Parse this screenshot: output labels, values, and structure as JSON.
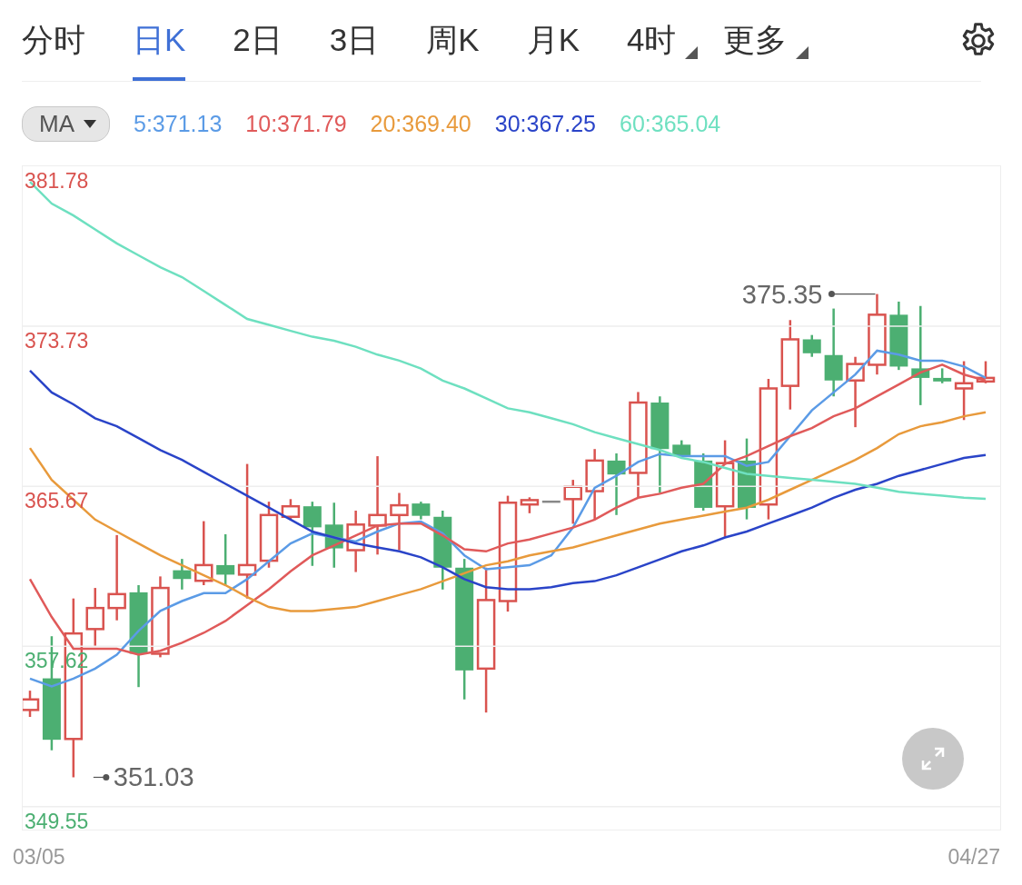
{
  "tabs": [
    {
      "label": "分时",
      "selected": false,
      "has_menu": false
    },
    {
      "label": "日K",
      "selected": true,
      "has_menu": false
    },
    {
      "label": "2日",
      "selected": false,
      "has_menu": false
    },
    {
      "label": "3日",
      "selected": false,
      "has_menu": false
    },
    {
      "label": "周K",
      "selected": false,
      "has_menu": false
    },
    {
      "label": "月K",
      "selected": false,
      "has_menu": false
    },
    {
      "label": "4时",
      "selected": false,
      "has_menu": true
    },
    {
      "label": "更多",
      "selected": false,
      "has_menu": true
    }
  ],
  "indicator_dropdown": {
    "label": "MA"
  },
  "chart": {
    "chart_data": {
      "type": "line",
      "ylim": [
        348.4,
        381.78
      ],
      "yticks": [
        381.78,
        373.73,
        365.67,
        357.62,
        349.55
      ],
      "series": [
        {
          "name": "5:371.13",
          "color": "#5b9be6",
          "values": [
            356.0,
            355.6,
            356.0,
            356.5,
            357.2,
            358.4,
            359.4,
            359.9,
            360.3,
            360.3,
            361.0,
            361.9,
            362.8,
            363.3,
            363.1,
            362.9,
            363.4,
            363.8,
            363.9,
            363.3,
            362.2,
            361.5,
            361.6,
            361.7,
            362.2,
            363.6,
            365.6,
            366.2,
            366.9,
            367.3,
            367.2,
            367.2,
            367.2,
            366.7,
            366.9,
            368.2,
            369.5,
            370.4,
            371.3,
            372.5,
            372.3,
            372.0,
            372.0,
            371.7,
            371.13
          ]
        },
        {
          "name": "10:371.79",
          "color": "#e05a5a",
          "values": [
            361.0,
            359.1,
            357.5,
            357.5,
            357.5,
            357.2,
            357.4,
            357.8,
            358.3,
            358.9,
            359.7,
            360.5,
            361.4,
            362.2,
            362.7,
            363.2,
            363.7,
            363.8,
            363.8,
            363.2,
            362.5,
            362.4,
            362.8,
            363.0,
            363.3,
            363.6,
            364.0,
            364.6,
            365.1,
            365.3,
            365.6,
            365.8,
            366.8,
            367.2,
            367.7,
            368.2,
            368.6,
            369.2,
            369.6,
            370.2,
            370.8,
            371.4,
            371.8,
            371.3,
            371.0
          ]
        },
        {
          "name": "20:369.40",
          "color": "#e89a3c",
          "values": [
            367.6,
            366.0,
            365.0,
            364.0,
            363.4,
            362.8,
            362.2,
            361.7,
            361.2,
            360.7,
            360.1,
            359.6,
            359.4,
            359.4,
            359.5,
            359.6,
            359.9,
            360.2,
            360.5,
            360.9,
            361.3,
            361.7,
            361.9,
            362.2,
            362.4,
            362.6,
            362.9,
            363.2,
            363.5,
            363.8,
            364.0,
            364.2,
            364.4,
            364.6,
            365.0,
            365.5,
            366.0,
            366.5,
            367.0,
            367.6,
            368.3,
            368.7,
            368.9,
            369.2,
            369.4
          ]
        },
        {
          "name": "30:367.25",
          "color": "#2a44c8",
          "values": [
            371.5,
            370.4,
            369.8,
            369.1,
            368.7,
            368.1,
            367.5,
            367.0,
            366.4,
            365.8,
            365.2,
            364.6,
            364.0,
            363.4,
            363.1,
            362.8,
            362.6,
            362.4,
            362.1,
            361.6,
            361.0,
            360.6,
            360.5,
            360.5,
            360.6,
            360.8,
            360.9,
            361.2,
            361.6,
            362.0,
            362.4,
            362.7,
            363.1,
            363.4,
            363.8,
            364.2,
            364.6,
            365.1,
            365.5,
            365.8,
            366.2,
            366.5,
            366.8,
            367.1,
            367.25
          ]
        },
        {
          "name": "60:365.04",
          "color": "#6ee0c0",
          "values": [
            381.0,
            379.9,
            379.3,
            378.6,
            377.9,
            377.3,
            376.7,
            376.2,
            375.5,
            374.8,
            374.1,
            373.8,
            373.5,
            373.2,
            373.0,
            372.7,
            372.3,
            372.0,
            371.6,
            371.0,
            370.6,
            370.1,
            369.6,
            369.4,
            369.1,
            368.8,
            368.4,
            368.1,
            367.8,
            367.5,
            367.1,
            366.9,
            366.6,
            366.3,
            366.2,
            366.1,
            366.0,
            365.9,
            365.8,
            365.6,
            365.4,
            365.3,
            365.2,
            365.1,
            365.04
          ]
        }
      ],
      "grid": true,
      "annotations": [
        {
          "text": "375.35"
        },
        {
          "text": "351.03"
        }
      ]
    },
    "date_range": {
      "start": "03/05",
      "end": "04/27"
    }
  }
}
